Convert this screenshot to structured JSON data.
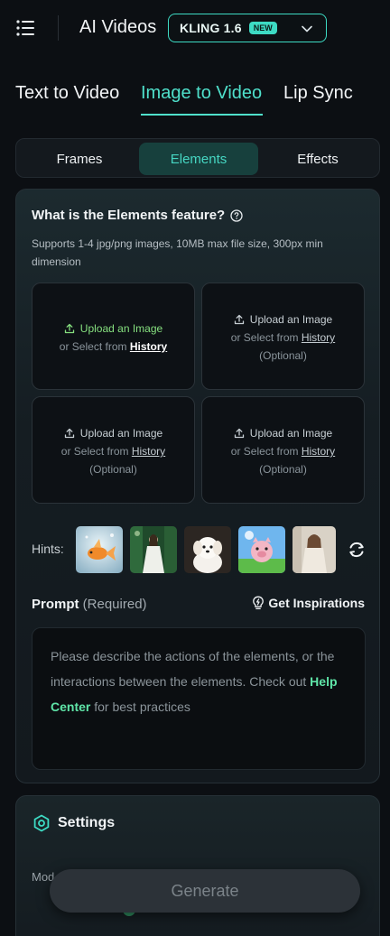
{
  "header": {
    "app_title": "AI Videos",
    "model_name": "KLING 1.6",
    "model_badge": "NEW"
  },
  "mode_tabs": [
    {
      "label": "Text to Video",
      "active": false
    },
    {
      "label": "Image to Video",
      "active": true
    },
    {
      "label": "Lip Sync",
      "active": false
    }
  ],
  "sub_tabs": [
    {
      "label": "Frames",
      "active": false
    },
    {
      "label": "Elements",
      "active": true
    },
    {
      "label": "Effects",
      "active": false
    }
  ],
  "elements": {
    "title": "What is the Elements feature?",
    "description": "Supports 1-4 jpg/png images, 10MB max file size, 300px min dimension",
    "upload_label": "Upload an Image",
    "select_prefix": "or Select from",
    "history_label": "History",
    "optional_label": "(Optional)"
  },
  "hints": {
    "label": "Hints:",
    "thumbnails": [
      "goldfish-photo",
      "woman-in-forest-photo",
      "white-puppy-photo",
      "cartoon-pig-photo",
      "woman-portrait-photo"
    ]
  },
  "prompt": {
    "label": "Prompt",
    "required": "(Required)",
    "inspire_label": "Get Inspirations",
    "placeholder_part1": "Please describe the actions of the elements, or the interactions between the elements. Check out ",
    "help_link": "Help Center",
    "placeholder_part2": " for best practices"
  },
  "settings": {
    "title": "Settings",
    "cut_label": "Mod"
  },
  "generate": {
    "label": "Generate"
  },
  "colors": {
    "accent": "#3ddbc4",
    "background": "#0c0f13",
    "upload_green": "#86e07f",
    "link_green": "#5fe5a8"
  }
}
